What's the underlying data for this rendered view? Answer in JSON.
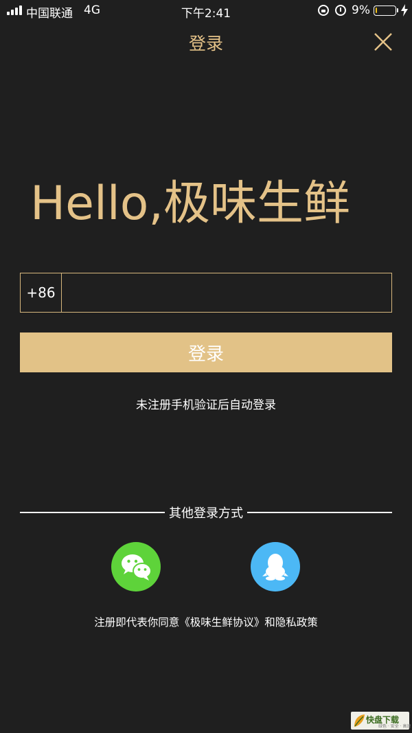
{
  "status_bar": {
    "carrier": "中国联通",
    "network": "4G",
    "time": "下午2:41",
    "battery_percent": "9%",
    "battery_level": 0.09,
    "battery_color": "#f5c518"
  },
  "nav": {
    "title": "登录",
    "close_icon": "close-icon"
  },
  "greeting": "Hello,极味生鲜",
  "phone_form": {
    "country_code": "+86",
    "phone_value": "",
    "phone_placeholder": ""
  },
  "login_button": {
    "label": "登录"
  },
  "auto_register_hint": "未注册手机验证后自动登录",
  "other_login": {
    "label": "其他登录方式",
    "methods": [
      {
        "icon": "wechat-icon",
        "color": "#5ed33a"
      },
      {
        "icon": "qq-icon",
        "color": "#4cb8f5"
      }
    ]
  },
  "agreement": "注册即代表你同意《极味生鲜协议》和隐私政策",
  "watermark": {
    "text": "快盘下载",
    "sub": "绿色 · 安全 · 高速"
  },
  "colors": {
    "background": "#1f1f1f",
    "accent": "#e4c288",
    "button": "#e2c287"
  }
}
